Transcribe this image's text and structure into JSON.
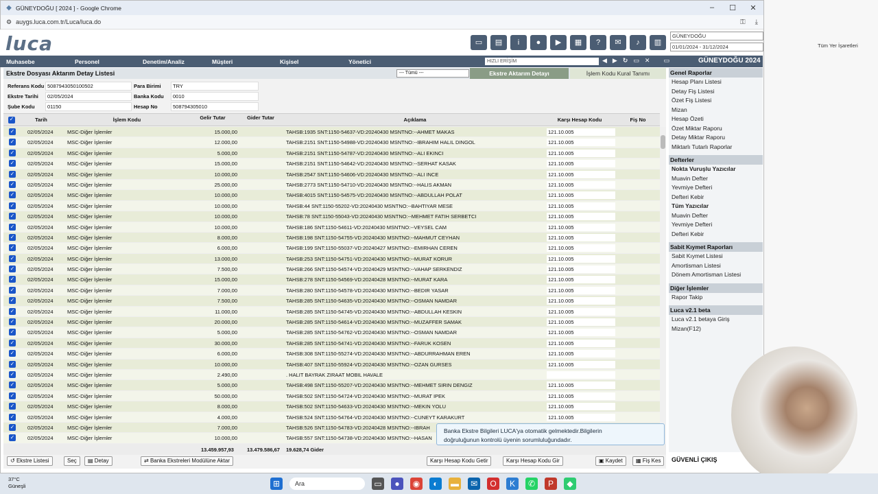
{
  "browser": {
    "title": "GÜNEYDOĞU [ 2024 ] - Google Chrome",
    "url": "auygs.luca.com.tr/Luca/luca.do",
    "bookmark_all": "Tüm Yer İşaretleri"
  },
  "header": {
    "logo": "luca",
    "company": "GÜNEYDOĞU",
    "period": "01/01/2024 - 31/12/2024"
  },
  "nav": {
    "items": [
      "Muhasebe",
      "Personel",
      "Denetim/Analiz",
      "Müşteri",
      "Kişisel",
      "Yönetici"
    ],
    "quick_access": "HIZLI ERİŞİM",
    "brand": "GÜNEYDOĞU 2024"
  },
  "panel": {
    "title": "Ekstre Dosyası Aktarım Detay Listesi",
    "filter": "--- Tümü ---",
    "tab_active": "Ekstre Aktarım Detayı",
    "tab_other": "İşlem Kodu Kural Tanımı"
  },
  "info": {
    "ref_label": "Referans Kodu",
    "ref_value": "5087943050100502",
    "date_label": "Ekstre Tarihi",
    "date_value": "02/05/2024",
    "branch_label": "Şube Kodu",
    "branch_value": "01150",
    "currency_label": "Para Birimi",
    "currency_value": "TRY",
    "bank_label": "Banka Kodu",
    "bank_value": "0010",
    "account_label": "Hesap No",
    "account_value": "508794305010"
  },
  "table": {
    "headers": {
      "tarih": "Tarih",
      "islem": "İşlem Kodu",
      "gelir": "Gelir Tutar",
      "gider": "Gider Tutar",
      "aciklama": "Açıklama",
      "karsi": "Karşı Hesap Kodu",
      "fis": "Fiş No"
    },
    "rows": [
      {
        "tarih": "02/05/2024",
        "kod": "MSC-Diğer İşlemler",
        "gelir": "15.000,00",
        "aciklama": "TAHSB:1935 SNT:1150-54637-VD:20240430 MSNTNO:--AHMET MAKAS",
        "karsi": "121.10.005"
      },
      {
        "tarih": "02/05/2024",
        "kod": "MSC-Diğer İşlemler",
        "gelir": "12.000,00",
        "aciklama": "TAHSB:2151 SNT:1150-54988-VD:20240430 MSNTNO:--IBRAHIM HALIL DINGOL",
        "karsi": "121.10.005"
      },
      {
        "tarih": "02/05/2024",
        "kod": "MSC-Diğer İşlemler",
        "gelir": "5.000,00",
        "aciklama": "TAHSB:2151 SNT:1150-54787-VD:20240430 MSNTNO:--ALI EKINCI",
        "karsi": "121.10.005"
      },
      {
        "tarih": "02/05/2024",
        "kod": "MSC-Diğer İşlemler",
        "gelir": "15.000,00",
        "aciklama": "TAHSB:2151 SNT:1150-54642-VD:20240430 MSNTNO:--SERHAT KASAK",
        "karsi": "121.10.005"
      },
      {
        "tarih": "02/05/2024",
        "kod": "MSC-Diğer İşlemler",
        "gelir": "10.000,00",
        "aciklama": "TAHSB:2547 SNT:1150-54606-VD:20240430 MSNTNO:--ALI INCE",
        "karsi": "121.10.005"
      },
      {
        "tarih": "02/05/2024",
        "kod": "MSC-Diğer İşlemler",
        "gelir": "25.000,00",
        "aciklama": "TAHSB:2773 SNT:1150-54710-VD:20240430 MSNTNO:--HALIS AKMAN",
        "karsi": "121.10.005"
      },
      {
        "tarih": "02/05/2024",
        "kod": "MSC-Diğer İşlemler",
        "gelir": "10.000,00",
        "aciklama": "TAHSB:4015 SNT:1150-54575-VD:20240430 MSNTNO:--ABDULLAH POLAT",
        "karsi": "121.10.005"
      },
      {
        "tarih": "02/05/2024",
        "kod": "MSC-Diğer İşlemler",
        "gelir": "10.000,00",
        "aciklama": "TAHSB:44 SNT:1150-55202-VD:20240430 MSNTNO:--BAHTIYAR MESE",
        "karsi": "121.10.005"
      },
      {
        "tarih": "02/05/2024",
        "kod": "MSC-Diğer İşlemler",
        "gelir": "10.000,00",
        "aciklama": "TAHSB:78 SNT:1150-55043-VD:20240430 MSNTNO:--MEHMET FATIH SERBETCI",
        "karsi": "121.10.005"
      },
      {
        "tarih": "02/05/2024",
        "kod": "MSC-Diğer İşlemler",
        "gelir": "10.000,00",
        "aciklama": "TAHSB:186 SNT:1150-54611-VD:20240430 MSNTNO:--VEYSEL CAM",
        "karsi": "121.10.005"
      },
      {
        "tarih": "02/05/2024",
        "kod": "MSC-Diğer İşlemler",
        "gelir": "8.000,00",
        "aciklama": "TAHSB:198 SNT:1150-54755-VD:20240430 MSNTNO:--MAHMUT CEYHAN",
        "karsi": "121.10.005"
      },
      {
        "tarih": "02/05/2024",
        "kod": "MSC-Diğer İşlemler",
        "gelir": "6.000,00",
        "aciklama": "TAHSB:199 SNT:1150-55037-VD:20240427 MSNTNO:--EMIRHAN CEREN",
        "karsi": "121.10.005"
      },
      {
        "tarih": "02/05/2024",
        "kod": "MSC-Diğer İşlemler",
        "gelir": "13.000,00",
        "aciklama": "TAHSB:253 SNT:1150-54751-VD:20240430 MSNTNO:--MURAT KORUR",
        "karsi": "121.10.005"
      },
      {
        "tarih": "02/05/2024",
        "kod": "MSC-Diğer İşlemler",
        "gelir": "7.500,00",
        "aciklama": "TAHSB:266 SNT:1150-54574-VD:20240429 MSNTNO:--VAHAP SERKENDIZ",
        "karsi": "121.10.005"
      },
      {
        "tarih": "02/05/2024",
        "kod": "MSC-Diğer İşlemler",
        "gelir": "15.000,00",
        "aciklama": "TAHSB:278 SNT:1150-54569-VD:20240428 MSNTNO:--MURAT KARA",
        "karsi": "121.10.005"
      },
      {
        "tarih": "02/05/2024",
        "kod": "MSC-Diğer İşlemler",
        "gelir": "7.000,00",
        "aciklama": "TAHSB:280 SNT:1150-54578-VD:20240430 MSNTNO:--BEDIR YASAR",
        "karsi": "121.10.005"
      },
      {
        "tarih": "02/05/2024",
        "kod": "MSC-Diğer İşlemler",
        "gelir": "7.500,00",
        "aciklama": "TAHSB:285 SNT:1150-54635-VD:20240430 MSNTNO:--OSMAN NAMDAR",
        "karsi": "121.10.005"
      },
      {
        "tarih": "02/05/2024",
        "kod": "MSC-Diğer İşlemler",
        "gelir": "11.000,00",
        "aciklama": "TAHSB:285 SNT:1150-54745-VD:20240430 MSNTNO:--ABDULLAH KESKIN",
        "karsi": "121.10.005"
      },
      {
        "tarih": "02/05/2024",
        "kod": "MSC-Diğer İşlemler",
        "gelir": "20.000,00",
        "aciklama": "TAHSB:285 SNT:1150-54614-VD:20240430 MSNTNO:--MUZAFFER SAMAK",
        "karsi": "121.10.005"
      },
      {
        "tarih": "02/05/2024",
        "kod": "MSC-Diğer İşlemler",
        "gelir": "5.000,00",
        "aciklama": "TAHSB:285 SNT:1150-54762-VD:20240430 MSNTNO:--OSMAN NAMDAR",
        "karsi": "121.10.005"
      },
      {
        "tarih": "02/05/2024",
        "kod": "MSC-Diğer İşlemler",
        "gelir": "30.000,00",
        "aciklama": "TAHSB:285 SNT:1150-54741-VD:20240430 MSNTNO:--FARUK KOSEN",
        "karsi": "121.10.005"
      },
      {
        "tarih": "02/05/2024",
        "kod": "MSC-Diğer İşlemler",
        "gelir": "6.000,00",
        "aciklama": "TAHSB:308 SNT:1150-55274-VD:20240430 MSNTNO:--ABDURRAHMAN EREN",
        "karsi": "121.10.005"
      },
      {
        "tarih": "02/05/2024",
        "kod": "MSC-Diğer İşlemler",
        "gelir": "10.000,00",
        "aciklama": "TAHSB:407 SNT:1150-55924-VD:20240430 MSNTNO:--OZAN GURSES",
        "karsi": "121.10.005"
      },
      {
        "tarih": "02/05/2024",
        "kod": "MSC-Diğer İşlemler",
        "gelir": "2.490,00",
        "aciklama": ". HALIT BAYRAK ZIRAAT MOBIL HAVALE",
        "karsi": ""
      },
      {
        "tarih": "02/05/2024",
        "kod": "MSC-Diğer İşlemler",
        "gelir": "5.000,00",
        "aciklama": "TAHSB:498 SNT:1150-55207-VD:20240430 MSNTNO:--MEHMET SIRIN DENGIZ",
        "karsi": "121.10.005"
      },
      {
        "tarih": "02/05/2024",
        "kod": "MSC-Diğer İşlemler",
        "gelir": "50.000,00",
        "aciklama": "TAHSB:502 SNT:1150-54724-VD:20240430 MSNTNO:--MURAT IPEK",
        "karsi": "121.10.005"
      },
      {
        "tarih": "02/05/2024",
        "kod": "MSC-Diğer İşlemler",
        "gelir": "8.000,00",
        "aciklama": "TAHSB:502 SNT:1150-54633-VD:20240430 MSNTNO:--MEKIN YOLU",
        "karsi": "121.10.005"
      },
      {
        "tarih": "02/05/2024",
        "kod": "MSC-Diğer İşlemler",
        "gelir": "4.000,00",
        "aciklama": "TAHSB:524 SNT:1150-54764-VD:20240430 MSNTNO:--CUNEYT KARAKURT",
        "karsi": "121.10.005"
      },
      {
        "tarih": "02/05/2024",
        "kod": "MSC-Diğer İşlemler",
        "gelir": "7.000,00",
        "aciklama": "TAHSB:526 SNT:1150-54783-VD:20240428 MSNTNO:--IBRAH",
        "karsi": ""
      },
      {
        "tarih": "02/05/2024",
        "kod": "MSC-Diğer İşlemler",
        "gelir": "10.000,00",
        "aciklama": "TAHSB:557 SNT:1150-54738-VD:20240430 MSNTNO:--HASAN",
        "karsi": ""
      }
    ],
    "totals": {
      "gelir": "13.459.957,93",
      "gider": "13.479.586,67",
      "fark": "19.628,74 Gider"
    }
  },
  "buttons": {
    "ekstre_listesi": "Ekstre Listesi",
    "sec": "Seç",
    "detay": "Detay",
    "aktar": "Banka Ekstreleri Modülüne Aktar",
    "karsi_getir": "Karşı Hesap Kodu Getir",
    "karsi_gir": "Karşı Hesap Kodu Gir",
    "kaydet": "Kaydet",
    "fis_kes": "Fiş Kes"
  },
  "tooltip": {
    "line1": "Banka Ekstre Bilgileri LUCA'ya otomatik gelmektedir.Bilgilerin",
    "line2": "doğruluğunun kontrolü üyenin sorumluluğundadır."
  },
  "sidebar": {
    "sections": [
      {
        "title": "Genel Raporlar",
        "items": [
          {
            "label": "Hesap Planı Listesi",
            "bold": false
          },
          {
            "label": "Detay Fiş Listesi",
            "bold": false
          },
          {
            "label": "Özet Fiş Listesi",
            "bold": false
          },
          {
            "label": "Mizan",
            "bold": false
          },
          {
            "label": "Hesap Özeti",
            "bold": false
          },
          {
            "label": "Özet Miktar Raporu",
            "bold": false
          },
          {
            "label": "Detay Miktar Raporu",
            "bold": false
          },
          {
            "label": "Miktarlı Tutarlı Raporlar",
            "bold": false
          }
        ]
      },
      {
        "title": "Defterler",
        "items": [
          {
            "label": "Nokta Vuruşlu Yazıcılar",
            "bold": true
          },
          {
            "label": "Muavin Defter",
            "bold": false
          },
          {
            "label": "Yevmiye Defteri",
            "bold": false
          },
          {
            "label": "Defteri Kebir",
            "bold": false
          },
          {
            "label": "Tüm Yazıcılar",
            "bold": true
          },
          {
            "label": "Muavin Defter",
            "bold": false
          },
          {
            "label": "Yevmiye Defteri",
            "bold": false
          },
          {
            "label": "Defteri Kebir",
            "bold": false
          }
        ]
      },
      {
        "title": "Sabit Kıymet Raporları",
        "items": [
          {
            "label": "Sabit Kıymet Listesi",
            "bold": false
          },
          {
            "label": "Amortisman Listesi",
            "bold": false
          },
          {
            "label": "Dönem Amortisman Listesi",
            "bold": false
          }
        ]
      },
      {
        "title": "Diğer İşlemler",
        "items": [
          {
            "label": "Rapor Takip",
            "bold": false
          }
        ]
      },
      {
        "title": "Luca v2.1 beta",
        "items": [
          {
            "label": "Luca v2.1 betaya Giriş",
            "bold": false
          },
          {
            "label": "Mizan(F12)",
            "bold": false
          }
        ]
      }
    ],
    "secure_exit": "GÜVENLİ ÇIKIŞ"
  },
  "taskbar": {
    "temp": "37°C",
    "weather": "Güneşli",
    "search": "Ara"
  }
}
